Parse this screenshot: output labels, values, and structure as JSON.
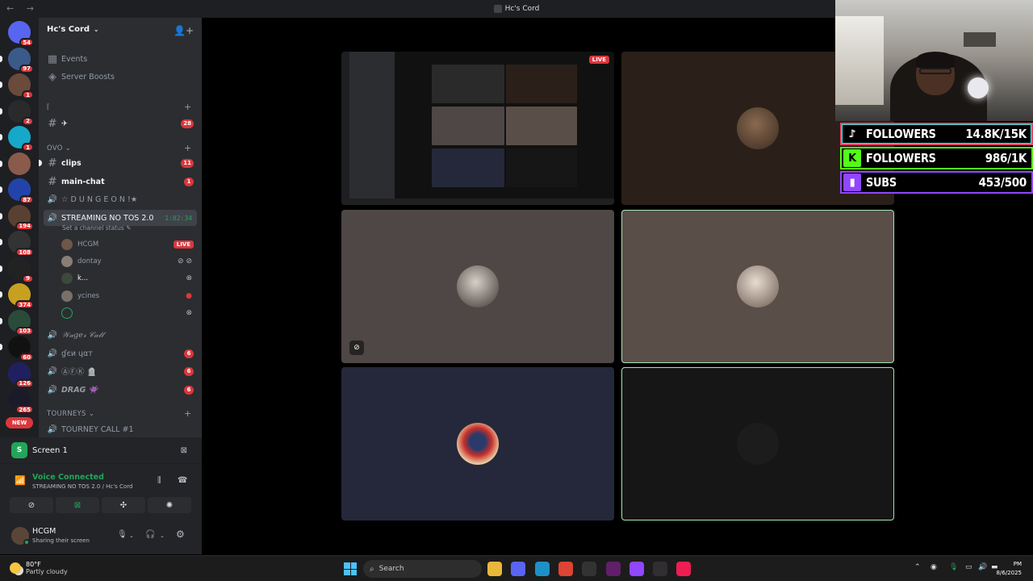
{
  "window": {
    "title": "Hc's Cord"
  },
  "rail": {
    "servers": [
      {
        "badge": "54",
        "color": "#5865f2",
        "icon": "discord-icon"
      },
      {
        "badge": "97",
        "color": "#3a5a8a"
      },
      {
        "badge": "1",
        "color": "#6a4a3a"
      },
      {
        "badge": "2",
        "color": "#2a2a2a"
      },
      {
        "badge": "1",
        "color": "#16a8c8"
      },
      {
        "badge": "",
        "color": "#8a5a4a"
      },
      {
        "badge": "87",
        "color": "#2244aa"
      },
      {
        "badge": "194",
        "color": "#5a4030"
      },
      {
        "badge": "108",
        "color": "#333"
      },
      {
        "badge": "9",
        "color": "#222"
      },
      {
        "badge": "374",
        "color": "#c8a020"
      },
      {
        "badge": "103",
        "color": "#2a4a3a"
      },
      {
        "badge": "60",
        "color": "#111"
      },
      {
        "badge": "126",
        "color": "#202060"
      },
      {
        "badge": "265",
        "color": "#1a1a2a"
      }
    ],
    "new_label": "NEW"
  },
  "sidebar": {
    "server_name": "Hc's Cord",
    "events": "Events",
    "server_boosts": "Server Boosts",
    "cat1_label": "⌈",
    "airplane_channel": {
      "name": "✈",
      "badge": "28"
    },
    "cat_ovo": "OVO",
    "channels": [
      {
        "name": "clips",
        "badge": "11"
      },
      {
        "name": "main-chat",
        "badge": "1"
      }
    ],
    "dungeon": "☆ D U N G E O N !★",
    "active_voice": {
      "name": "STREAMING NO TOS 2.0",
      "timer": "1:02:34",
      "status": "Set a channel status"
    },
    "voice_users": [
      {
        "name": "HCGM",
        "live": "LIVE"
      },
      {
        "name": "dontay"
      },
      {
        "name": "k..."
      },
      {
        "name": "ycines"
      },
      {
        "name": ""
      }
    ],
    "more_channels": [
      {
        "name": "𝒲𝒶𝑔𝑒𝓇 𝒞𝒶𝓁𝓁",
        "badge": ""
      },
      {
        "name": "ɠєи ɥαт",
        "badge": "6"
      },
      {
        "name": "ⒶⒻⓀ 🪦",
        "badge": "6"
      },
      {
        "name": "DRAG 👾",
        "badge": "6"
      }
    ],
    "cat_tourneys": "TOURNEYS",
    "tourney_call": "TOURNEY CALL #1"
  },
  "screen_panel": {
    "icon_letter": "S",
    "label": "Screen 1"
  },
  "voice_panel": {
    "title": "Voice Connected",
    "subtitle": "STREAMING NO TOS 2.0 / Hc's Cord"
  },
  "account": {
    "name": "HCGM",
    "status": "Sharing their screen"
  },
  "stage": {
    "live_label": "LIVE"
  },
  "overlay": {
    "stats": [
      {
        "platform": "tiktok",
        "label": "FOLLOWERS",
        "value": "14.8K/15K"
      },
      {
        "platform": "kick",
        "label": "FOLLOWERS",
        "value": "986/1K"
      },
      {
        "platform": "twitch",
        "label": "SUBS",
        "value": "453/500"
      }
    ]
  },
  "taskbar": {
    "temp": "80°F",
    "weather": "Partly cloudy",
    "search_placeholder": "Search",
    "apps": [
      {
        "icon": "file-explorer-icon",
        "color": "#e8b83a"
      },
      {
        "icon": "discord-icon",
        "color": "#5865f2"
      },
      {
        "icon": "edge-icon",
        "color": "#1e90c8"
      },
      {
        "icon": "chrome-icon",
        "color": "#dd4433"
      },
      {
        "icon": "media-player-icon",
        "color": "#333"
      },
      {
        "icon": "slack-icon",
        "color": "#611f69"
      },
      {
        "icon": "twitch-icon",
        "color": "#9146ff"
      },
      {
        "icon": "obs-icon",
        "color": "#302e31"
      },
      {
        "icon": "tiktok-icon",
        "color": "#ee1d52"
      }
    ],
    "clock_time": "PM",
    "clock_date": "8/6/2025"
  }
}
